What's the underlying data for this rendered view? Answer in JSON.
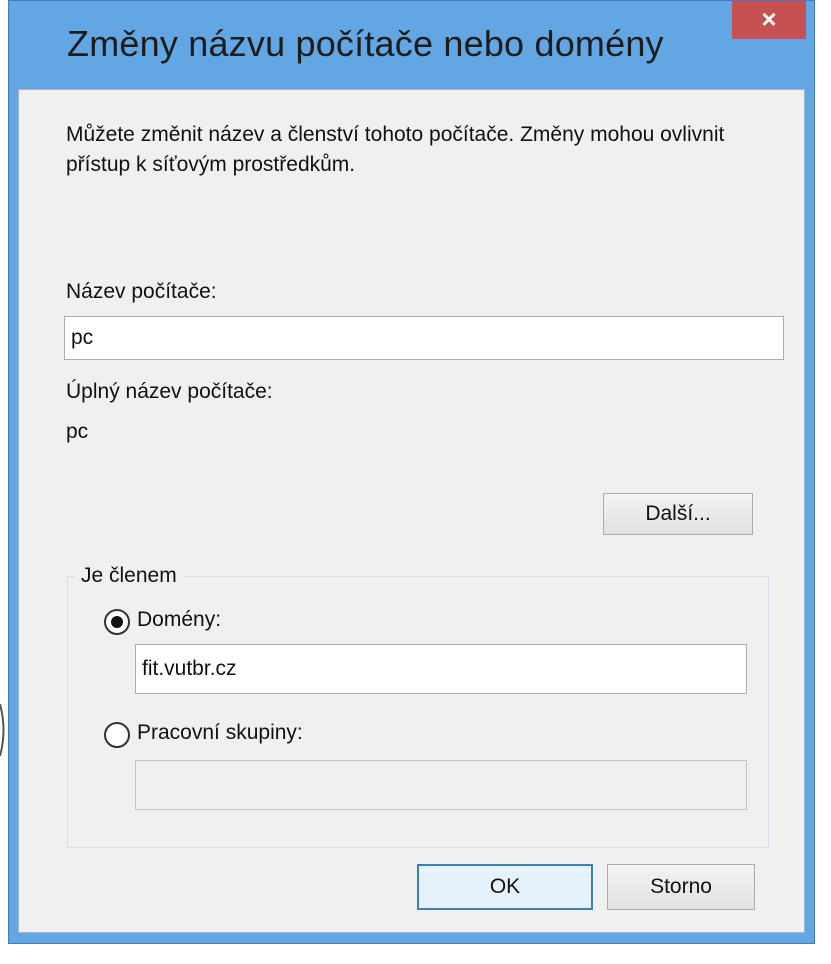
{
  "dialog": {
    "title": "Změny názvu počítače nebo domény",
    "close_label": "×",
    "intro": "Můžete změnit název a členství tohoto počítače. Změny mohou ovlivnit přístup k síťovým prostředkům.",
    "computer_name_label": "Název počítače:",
    "computer_name_value": "pc",
    "full_name_label": "Úplný název počítače:",
    "full_name_value": "pc",
    "more_button": "Další...",
    "member_of": {
      "label": "Je členem",
      "domain_label": "Domény:",
      "domain_value": "fit.vutbr.cz",
      "domain_selected": true,
      "workgroup_label": "Pracovní skupiny:",
      "workgroup_value": "",
      "workgroup_selected": false
    },
    "ok_button": "OK",
    "cancel_button": "Storno"
  },
  "colors": {
    "frame": "#62a6e3",
    "close": "#c75050",
    "client": "#f0f0f0"
  }
}
